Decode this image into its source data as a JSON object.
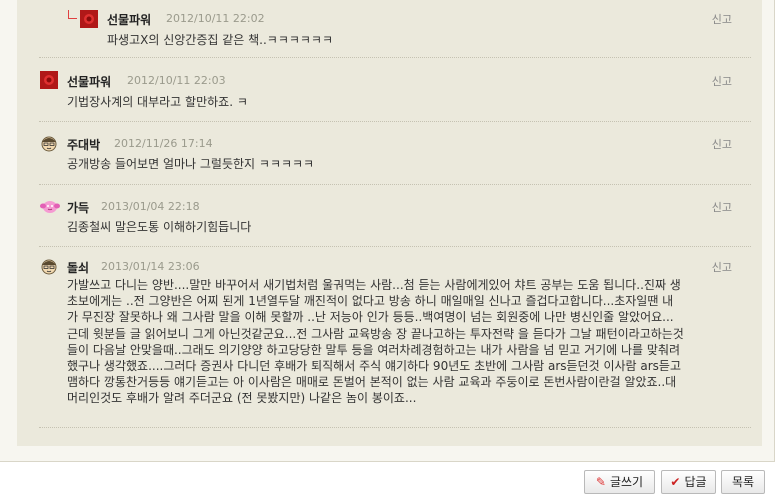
{
  "comments": [
    {
      "nick": "선물파워",
      "date": "2012/10/11 22:02",
      "report": "신고",
      "text": "파생고X의 신앙간증집 같은 책..ㅋㅋㅋㅋㅋㅋ",
      "reply": true
    },
    {
      "nick": "선물파워",
      "date": "2012/10/11 22:03",
      "report": "신고",
      "text": "기법장사계의 대부라고 할만하죠. ㅋ"
    },
    {
      "nick": "주대박",
      "date": "2012/11/26 17:14",
      "report": "신고",
      "text": "공개방송 들어보면 얼마나 그럴듯한지 ㅋㅋㅋㅋㅋ"
    },
    {
      "nick": "가득",
      "date": "2013/01/04 22:18",
      "report": "신고",
      "text": "김종철씨 말은도통 이해하기힘듭니다"
    },
    {
      "nick": "돌쇠",
      "date": "2013/01/14 23:06",
      "report": "신고",
      "lines": [
        "가발쓰고 다니는 양반....말만 바꾸어서 새기법처럼 울궈먹는 사람...첨 듣는 사람에게있어 챠트 공부는 도움 됩니다..진짜 생",
        "초보에게는 ..전 그양반은 어찌 된게 1년열두달 깨진적이 없다고 방송 하니 매일매일 신나고 즐겁다고합니다...초자일땐 내",
        "가 무진장 잘못하나 왜 그사람 말을 이해 못할까 ..난 저능아 인가 등등..백여명이 넘는 회원중에 나만 병신인줄 알았어요...",
        "근데 윗분들 글 읽어보니 그게 아닌것같군요...전 그사람 교육방송 장 끝나고하는 투자전략 을 듣다가 그날 패턴이라고하는것",
        "들이 다음날 안맞을때..그래도 의기양양 하고당당한 말투 등을 여러차례경험하고는 내가 사람을 넘 믿고 거기에 나를 맞춰려",
        "했구나 생각했죠....그러다 증권사 다니던 후배가 퇴직해서 주식 얘기하다 90년도 초반에 그사람 ars듣던것 이사람 ars듣고",
        "맴하다 깡통찬거등등 얘기듣고는 아 이사람은 매매로 돈벌어 본적이 없는 사람 교육과 주둥이로 돈번사람이란걸 알았죠..대",
        "머리인것도 후배가 알려 주더군요 (전 못봤지만) 나같은 놈이 봉이죠..."
      ]
    }
  ],
  "buttons": {
    "write": "글쓰기",
    "reply": "답글",
    "list": "목록"
  },
  "colors": {
    "panel": "#ebe9dc",
    "border": "#d9d6c8",
    "date": "#9a9a8c"
  }
}
